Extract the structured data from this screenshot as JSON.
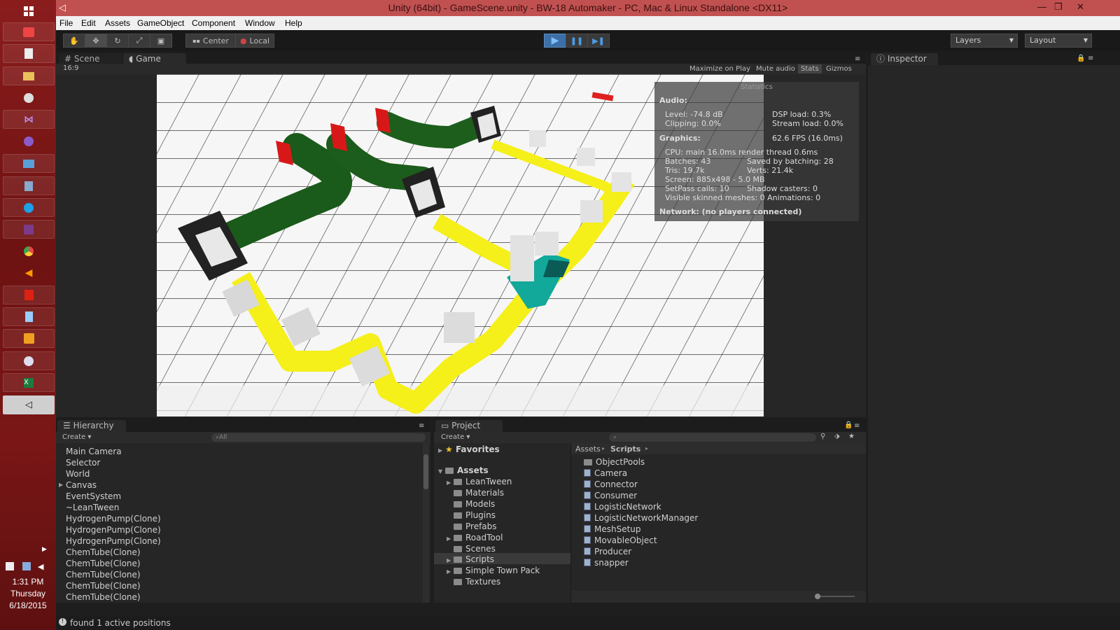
{
  "window": {
    "title": "Unity (64bit) - GameScene.unity - BW-18 Automaker - PC, Mac & Linux Standalone <DX11>"
  },
  "menu": [
    "File",
    "Edit",
    "Assets",
    "GameObject",
    "Component",
    "Window",
    "Help"
  ],
  "toolbar": {
    "pivot_center": "Center",
    "pivot_local": "Local",
    "layers": "Layers",
    "layout": "Layout"
  },
  "tabs": {
    "scene": "Scene",
    "game": "Game",
    "inspector": "Inspector",
    "hierarchy": "Hierarchy",
    "project": "Project"
  },
  "game": {
    "aspect": "16:9",
    "maximize": "Maximize on Play",
    "mute": "Mute audio",
    "stats": "Stats",
    "gizmos": "Gizmos"
  },
  "stats": {
    "title": "Statistics",
    "audio": "Audio:",
    "level": "Level: -74.8 dB",
    "dsp": "DSP load: 0.3%",
    "clipping": "Clipping: 0.0%",
    "stream": "Stream load: 0.0%",
    "graphics": "Graphics:",
    "fps": "62.6 FPS (16.0ms)",
    "cpu": "CPU: main 16.0ms  render thread 0.6ms",
    "batches": "Batches: 43",
    "saved": "Saved by batching: 28",
    "tris": "Tris: 19.7k",
    "verts": "Verts: 21.4k",
    "screen": "Screen: 885x498 - 5.0 MB",
    "setpass": "SetPass calls: 10",
    "shadow": "Shadow casters: 0",
    "skinned": "Visible skinned meshes: 0  Animations: 0",
    "network": "Network: (no players connected)"
  },
  "hierarchy": {
    "create": "Create",
    "search_placeholder": "All",
    "items": [
      "Main Camera",
      "Selector",
      "World",
      "Canvas",
      "EventSystem",
      "~LeanTween",
      "HydrogenPump(Clone)",
      "HydrogenPump(Clone)",
      "HydrogenPump(Clone)",
      "ChemTube(Clone)",
      "ChemTube(Clone)",
      "ChemTube(Clone)",
      "ChemTube(Clone)",
      "ChemTube(Clone)"
    ]
  },
  "project": {
    "create": "Create",
    "favorites": "Favorites",
    "assets": "Assets",
    "folders": [
      "LeanTween",
      "Materials",
      "Models",
      "Plugins",
      "Prefabs",
      "RoadTool",
      "Scenes",
      "Scripts",
      "Simple Town Pack",
      "Textures"
    ],
    "breadcrumb_root": "Assets",
    "breadcrumb_current": "Scripts",
    "files": [
      "ObjectPools",
      "Camera",
      "Connector",
      "Consumer",
      "LogisticNetwork",
      "LogisticNetworkManager",
      "MeshSetup",
      "MovableObject",
      "Producer",
      "snapper"
    ]
  },
  "status": {
    "message": "found 1 active positions"
  },
  "clock": {
    "time": "1:31 PM",
    "day": "Thursday",
    "date": "6/18/2015"
  }
}
